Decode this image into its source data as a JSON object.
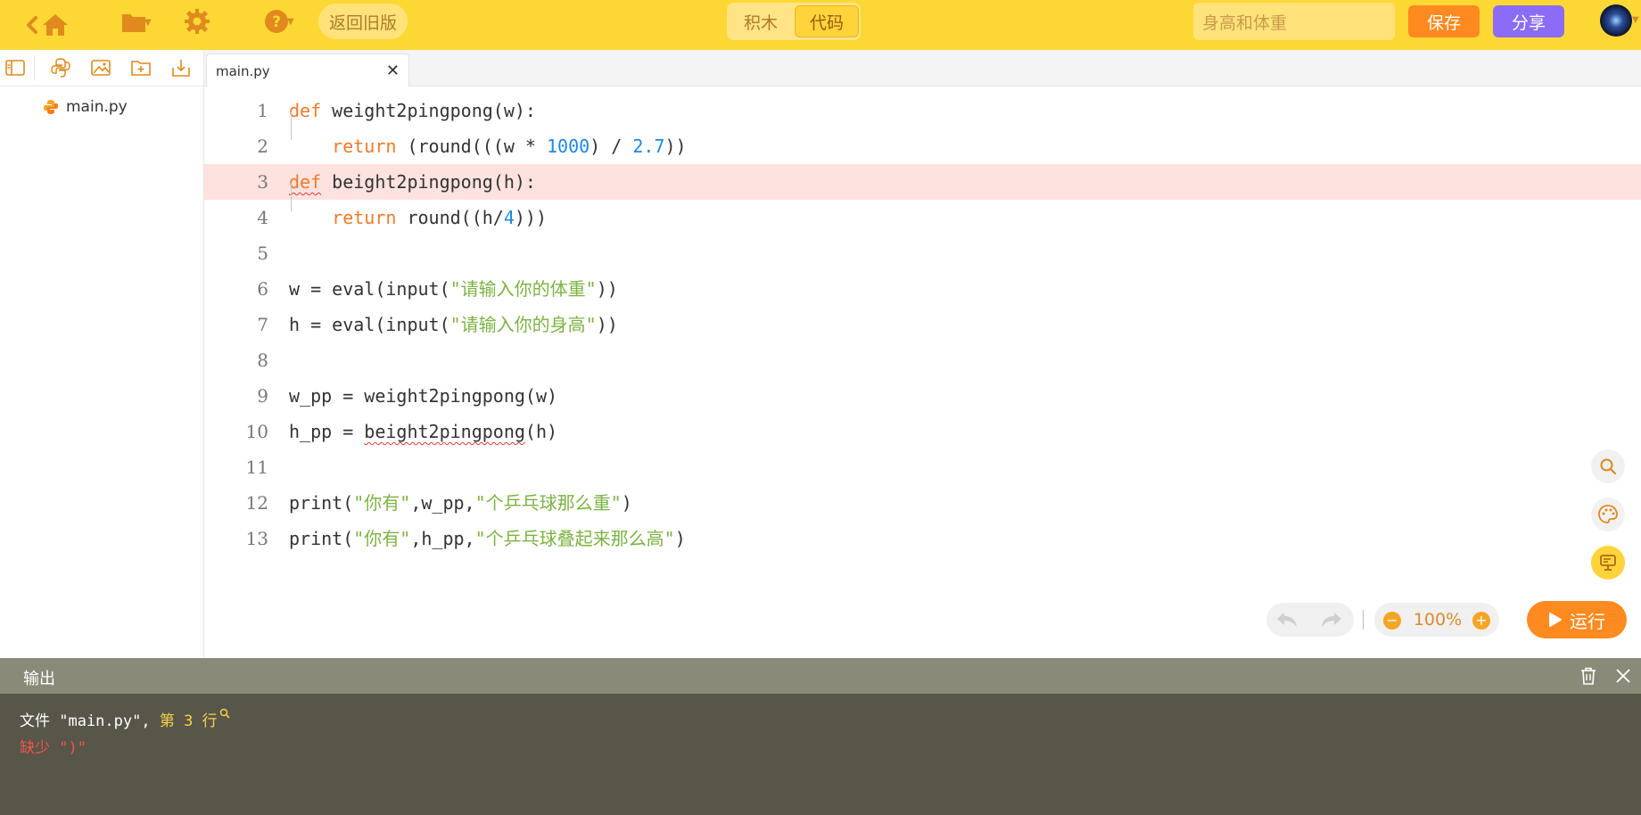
{
  "toolbar": {
    "back_old_label": "返回旧版",
    "mode_blocks": "积木",
    "mode_code": "代码",
    "project_name_placeholder": "身高和体重",
    "save_label": "保存",
    "share_label": "分享"
  },
  "file_tree": {
    "files": [
      {
        "name": "main.py",
        "icon": "python-icon"
      }
    ]
  },
  "editor": {
    "tab_label": "main.py",
    "error_line": 3,
    "lines": [
      {
        "n": "1",
        "code": "def weight2pingpong(w):"
      },
      {
        "n": "2",
        "code": "    return (round(((w * 1000) / 2.7))"
      },
      {
        "n": "3",
        "code": "def beight2pingpong(h):"
      },
      {
        "n": "4",
        "code": "    return round((h/4)))"
      },
      {
        "n": "5",
        "code": ""
      },
      {
        "n": "6",
        "code": "w = eval(input(\"请输入你的体重\"))"
      },
      {
        "n": "7",
        "code": "h = eval(input(\"请输入你的身高\"))"
      },
      {
        "n": "8",
        "code": ""
      },
      {
        "n": "9",
        "code": "w_pp = weight2pingpong(w)"
      },
      {
        "n": "10",
        "code": "h_pp = beight2pingpong(h)"
      },
      {
        "n": "11",
        "code": ""
      },
      {
        "n": "12",
        "code": "print(\"你有\",w_pp,\"个乒乓球那么重\")"
      },
      {
        "n": "13",
        "code": "print(\"你有\",h_pp,\"个乒乓球叠起来那么高\")"
      }
    ]
  },
  "controls": {
    "zoom": "100%",
    "run_label": "运行"
  },
  "output": {
    "title": "输出",
    "line1_prefix": "文件 \"main.py\", ",
    "line1_link": "第 3 行",
    "line2": "缺少 \")\""
  },
  "colors": {
    "topbar": "#fdd835",
    "accent_orange": "#ff8a1f",
    "share_purple": "#8b6cf6",
    "error_highlight": "#fde2df",
    "keyword": "#f17a28",
    "number": "#1e88e5",
    "string": "#7cb342"
  }
}
